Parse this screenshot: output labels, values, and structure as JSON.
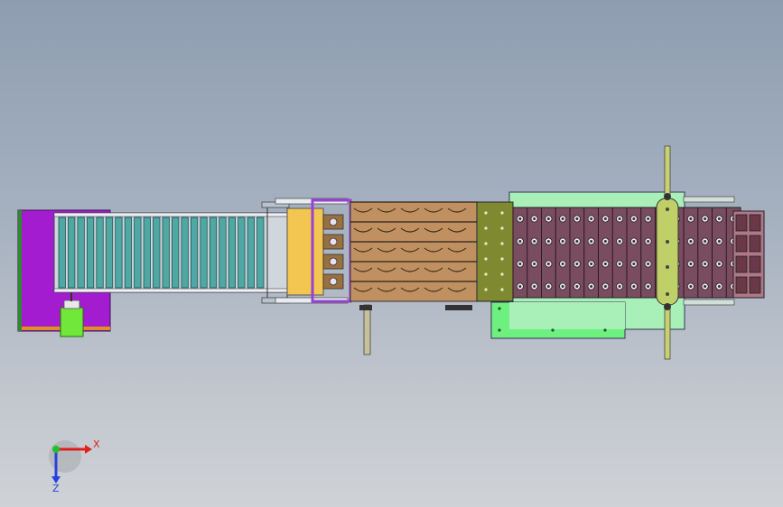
{
  "viewport": {
    "background_top": "#8e9db1",
    "background_bottom": "#cfd2d6"
  },
  "triad": {
    "x_label": "X",
    "z_label": "Z",
    "x_color": "#e0201c",
    "y_color": "#22c02a",
    "z_color": "#2840e0"
  },
  "colors": {
    "motor_base": "#a41ccf",
    "motor": "#6fe83a",
    "belt_slat": "#4fa8a4",
    "belt_frame": "#cfd6dc",
    "transfer_plate": "#f2c650",
    "purple_frame": "#9a40d8",
    "wood_tray": "#c09060",
    "olive_block": "#7f8a30",
    "station_base": "#a8f0b8",
    "mold_bank": "#7a4c60",
    "clamp_bar": "#c0d068"
  },
  "counts": {
    "belt_slats": 22,
    "mold_columns": 16,
    "mold_rows": 4,
    "wood_lanes": 5
  }
}
